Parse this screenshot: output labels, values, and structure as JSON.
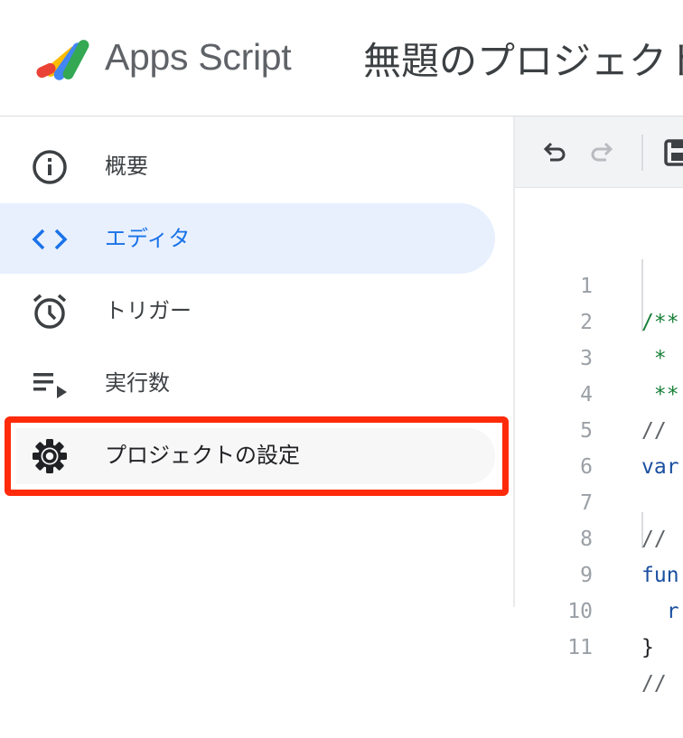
{
  "header": {
    "app_name": "Apps Script",
    "project_title": "無題のプロジェクト"
  },
  "sidebar": {
    "items": [
      {
        "label": "概要",
        "icon": "info-icon",
        "active": false
      },
      {
        "label": "エディタ",
        "icon": "code-icon",
        "active": true
      },
      {
        "label": "トリガー",
        "icon": "alarm-clock-icon",
        "active": false
      },
      {
        "label": "実行数",
        "icon": "executions-list-icon",
        "active": false
      },
      {
        "label": "プロジェクトの設定",
        "icon": "gear-icon",
        "active": false,
        "highlighted": true
      }
    ]
  },
  "editor": {
    "toolbar": {
      "undo": "undo-icon",
      "redo": "redo-icon",
      "save": "save-icon"
    },
    "lines": [
      {
        "n": "1",
        "text": "/**"
      },
      {
        "n": "2",
        "text": " *"
      },
      {
        "n": "3",
        "text": " **"
      },
      {
        "n": "4",
        "text": "//"
      },
      {
        "n": "5",
        "text": "var"
      },
      {
        "n": "6",
        "text": ""
      },
      {
        "n": "7",
        "text": "// ."
      },
      {
        "n": "8",
        "text": "fun"
      },
      {
        "n": "9",
        "text": "  r"
      },
      {
        "n": "10",
        "text": "}"
      },
      {
        "n": "11",
        "text": "//"
      }
    ]
  },
  "colors": {
    "accent": "#1a73e8",
    "active_bg": "#e8f0fe",
    "highlight_border": "#ff2a0a"
  }
}
